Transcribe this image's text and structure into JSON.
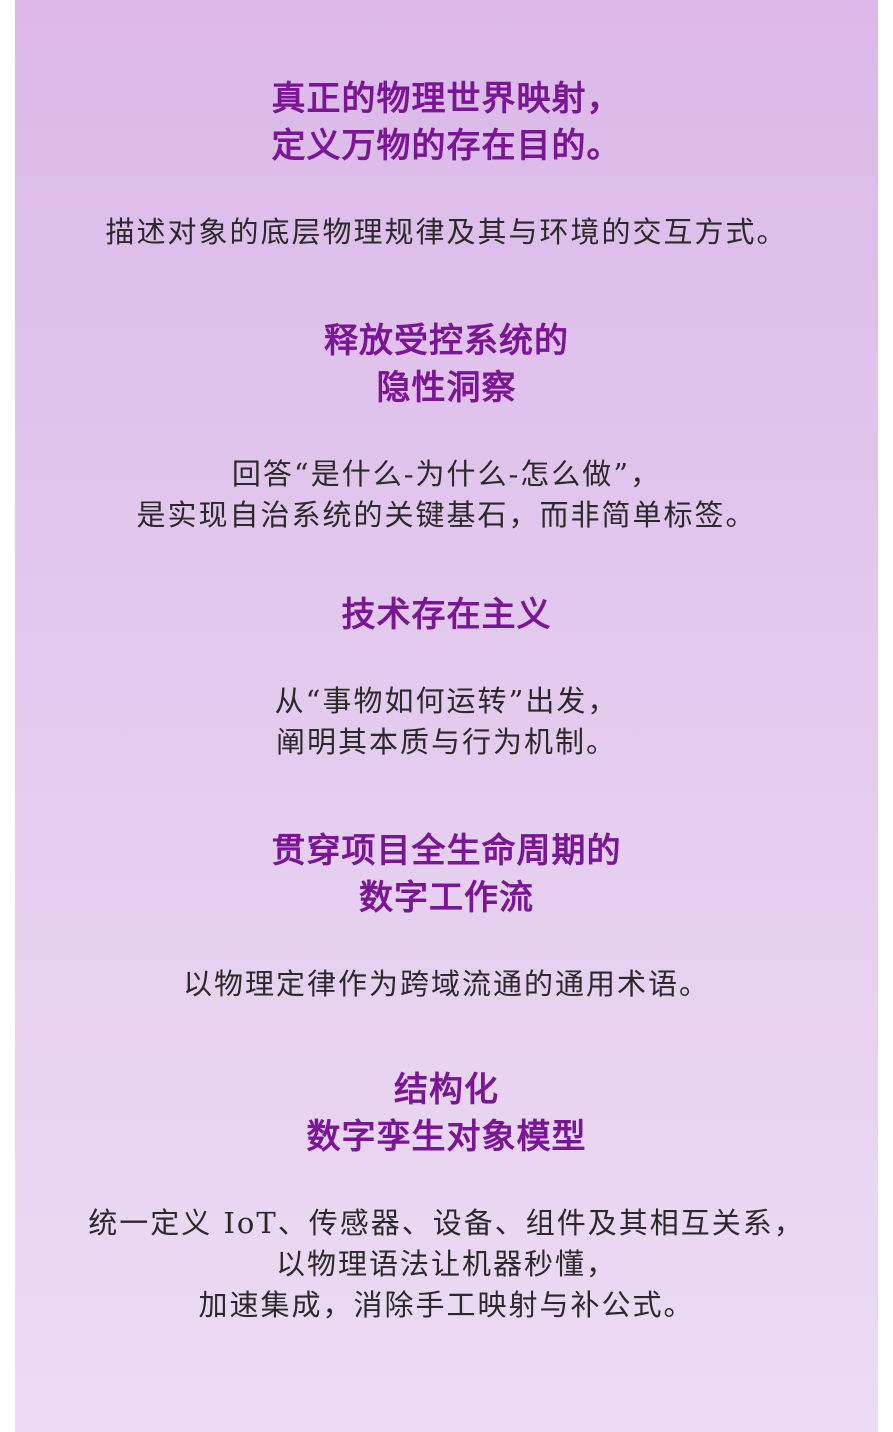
{
  "sections": [
    {
      "heading_lines": [
        "真正的物理世界映射，",
        "定义万物的存在目的。"
      ],
      "body_lines": [
        "描述对象的底层物理规律及其与环境的交互方式。"
      ]
    },
    {
      "heading_lines": [
        "释放受控系统的",
        "隐性洞察"
      ],
      "body_lines": [
        "回答“是什么-为什么-怎么做”，",
        "是实现自治系统的关键基石，而非简单标签。"
      ]
    },
    {
      "heading_lines": [
        "技术存在主义"
      ],
      "body_lines": [
        "从“事物如何运转”出发，",
        "阐明其本质与行为机制。"
      ]
    },
    {
      "heading_lines": [
        "贯穿项目全生命周期的",
        "数字工作流"
      ],
      "body_lines": [
        "以物理定律作为跨域流通的通用术语。"
      ]
    },
    {
      "heading_lines": [
        "结构化",
        "数字孪生对象模型"
      ],
      "body_lines": [
        "统一定义 IoT、传感器、设备、组件及其相互关系，",
        "以物理语法让机器秒懂，",
        "加速集成，消除手工映射与补公式。"
      ]
    }
  ],
  "colors": {
    "heading": "#7a1596",
    "body_text": "#2a2a2a",
    "background_top": "#dbb8e8",
    "background_bottom": "#ecdcf3"
  }
}
